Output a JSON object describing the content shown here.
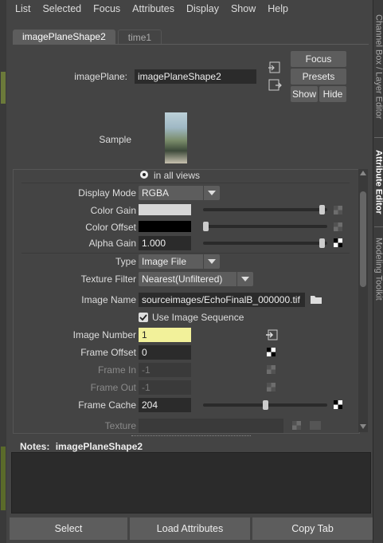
{
  "menu": [
    "List",
    "Selected",
    "Focus",
    "Attributes",
    "Display",
    "Show",
    "Help"
  ],
  "side_tabs": [
    "Channel Box / Layer Editor",
    "Attribute Editor",
    "Modeling Toolkit"
  ],
  "tabs": [
    "imagePlaneShape2",
    "time1"
  ],
  "image_plane": {
    "label": "imagePlane:",
    "value": "imagePlaneShape2"
  },
  "buttons": {
    "focus": "Focus",
    "presets": "Presets",
    "show": "Show",
    "hide": "Hide"
  },
  "sample_label": "Sample",
  "in_all_views": "in all views",
  "display_mode": {
    "label": "Display Mode",
    "value": "RGBA"
  },
  "color_gain": {
    "label": "Color Gain",
    "color": "#d6d6d6",
    "level": 0.98
  },
  "color_offset": {
    "label": "Color Offset",
    "color": "#000000",
    "level": 0.0
  },
  "alpha_gain": {
    "label": "Alpha Gain",
    "value": "1.000",
    "level": 0.98
  },
  "type": {
    "label": "Type",
    "value": "Image File"
  },
  "texture_filter": {
    "label": "Texture Filter",
    "value": "Nearest(Unfiltered)"
  },
  "image_name": {
    "label": "Image Name",
    "value": "sourceimages/EchoFinalB_000000.tif"
  },
  "use_image_sequence": "Use Image Sequence",
  "image_number": {
    "label": "Image Number",
    "value": "1"
  },
  "frame_offset": {
    "label": "Frame Offset",
    "value": "0"
  },
  "frame_in": {
    "label": "Frame In",
    "value": "-1"
  },
  "frame_out": {
    "label": "Frame Out",
    "value": "-1"
  },
  "frame_cache": {
    "label": "Frame Cache",
    "value": "204",
    "level": 0.5
  },
  "texture": {
    "label": "Texture"
  },
  "notes": {
    "label": "Notes:",
    "target": "imagePlaneShape2"
  },
  "bottom": {
    "select": "Select",
    "load": "Load Attributes",
    "copy": "Copy Tab"
  }
}
